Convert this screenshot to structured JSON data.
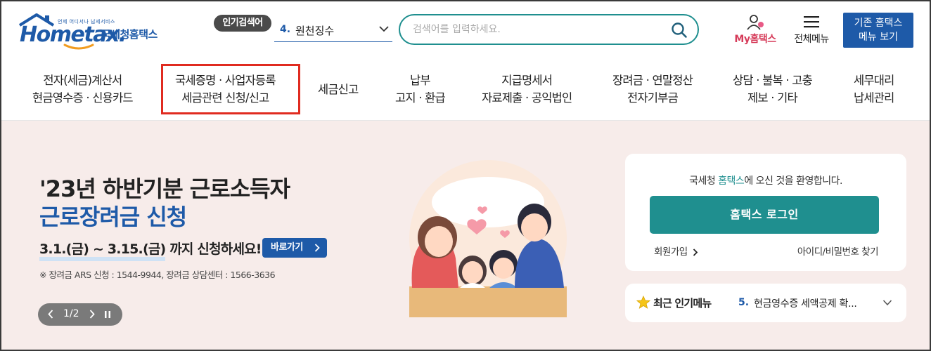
{
  "header": {
    "logo_text": "Hometax.",
    "logo_tagline": "언제 어디서나 납세서비스",
    "logo_org": "국세청홈택스",
    "popular_badge": "인기검색어",
    "popular_rank": "4.",
    "popular_term": "원천징수",
    "search_placeholder": "검색어를 입력하세요.",
    "my_hometax": "My홈택스",
    "all_menu": "전체메뉴",
    "old_menu_line1": "기존 홈택스",
    "old_menu_line2": "메뉴 보기"
  },
  "gnb": {
    "items": [
      {
        "line1": "전자(세금)계산서",
        "line2": "현금영수증 · 신용카드"
      },
      {
        "line1": "국세증명 · 사업자등록",
        "line2": "세금관련 신청/신고"
      },
      {
        "line1": "세금신고"
      },
      {
        "line1": "납부",
        "line2": "고지 · 환급"
      },
      {
        "line1": "지급명세서",
        "line2": "자료제출 · 공익법인"
      },
      {
        "line1": "장려금 · 연말정산",
        "line2": "전자기부금"
      },
      {
        "line1": "상담 · 불복 · 고충",
        "line2": "제보 · 기타"
      },
      {
        "line1": "세무대리",
        "line2": "납세관리"
      }
    ]
  },
  "hero": {
    "title_line1": "'23년 하반기분 근로소득자",
    "title_line2": "근로장려금 신청",
    "date_text": "3.1.(금) ~ 3.15.(금)",
    "date_suffix": " 까지 신청하세요!",
    "go_button": "바로가기",
    "note": "※ 장려금 ARS 신청 : 1544-9944, 장려금 상담센터 : 1566-3636",
    "pager": "1/2"
  },
  "login": {
    "welcome_prefix": "국세청 ",
    "welcome_brand": "홈택스",
    "welcome_suffix": "에 오신 것을 환영합니다.",
    "login_button": "홈택스 로그인",
    "join": "회원가입",
    "find": "아이디/비밀번호 찾기"
  },
  "recent": {
    "title": "최근 인기메뉴",
    "rank": "5.",
    "item": "현금영수증 세액공제 확..."
  },
  "colors": {
    "brand_blue": "#1e5aa8",
    "teal": "#1f8f8f",
    "hero_bg": "#f7ecea",
    "highlight_red": "#e02b20",
    "my_pink": "#d63c5a"
  }
}
